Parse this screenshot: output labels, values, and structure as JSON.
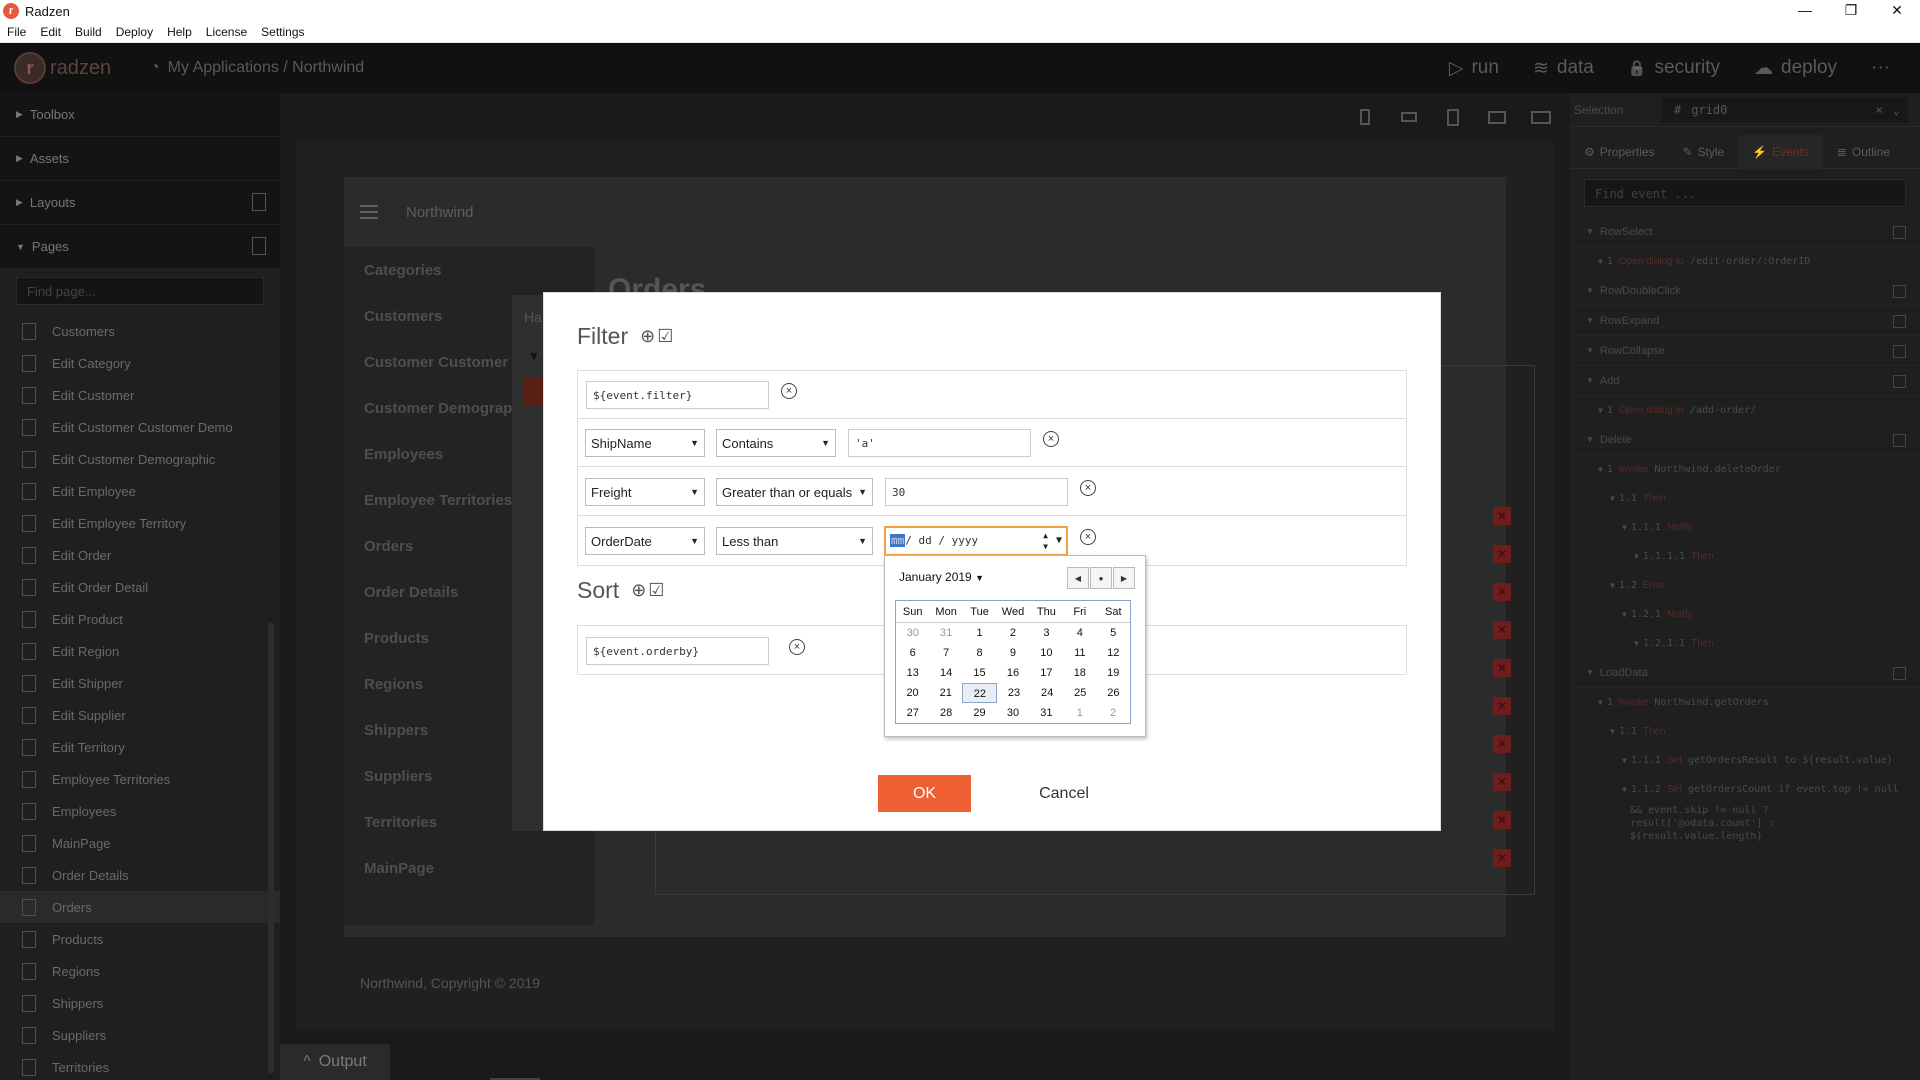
{
  "window": {
    "title": "Radzen",
    "controls": [
      "—",
      "❐",
      "✕"
    ]
  },
  "menu": [
    "File",
    "Edit",
    "Build",
    "Deploy",
    "Help",
    "License",
    "Settings"
  ],
  "header": {
    "brand": "radzen",
    "breadcrumb": "My Applications / Northwind",
    "nav": [
      {
        "icon": "play-icon",
        "glyph": "▷",
        "label": "run"
      },
      {
        "icon": "database-icon",
        "glyph": "≋",
        "label": "data"
      },
      {
        "icon": "lock-icon",
        "glyph": "🔒",
        "label": "security"
      },
      {
        "icon": "cloud-upload-icon",
        "glyph": "☁",
        "label": "deploy"
      }
    ],
    "more": "···"
  },
  "sidebar": {
    "sections": [
      "Toolbox",
      "Assets",
      "Layouts",
      "Pages"
    ],
    "search_placeholder": "Find page...",
    "pages": [
      "Customers",
      "Edit Category",
      "Edit Customer",
      "Edit Customer Customer Demo",
      "Edit Customer Demographic",
      "Edit Employee",
      "Edit Employee Territory",
      "Edit Order",
      "Edit Order Detail",
      "Edit Product",
      "Edit Region",
      "Edit Shipper",
      "Edit Supplier",
      "Edit Territory",
      "Employee Territories",
      "Employees",
      "MainPage",
      "Order Details",
      "Orders",
      "Products",
      "Regions",
      "Shippers",
      "Suppliers",
      "Territories"
    ],
    "active_page": "Orders"
  },
  "canvas": {
    "app_title": "Northwind",
    "nav": [
      "Categories",
      "Customers",
      "Customer Customer De",
      "Customer Demographi",
      "Employees",
      "Employee Territories",
      "Orders",
      "Order Details",
      "Products",
      "Regions",
      "Shippers",
      "Suppliers",
      "Territories",
      "MainPage"
    ],
    "content_title": "Orders",
    "footer": "Northwind, Copyright © 2019",
    "partial_label": "Ha"
  },
  "right_panel": {
    "selection_label": "Selection",
    "selection_value": "grid0",
    "tabs": [
      "Properties",
      "Style",
      "Events",
      "Outline"
    ],
    "active_tab": "Events",
    "find_placeholder": "Find event ...",
    "events": [
      {
        "name": "RowSelect",
        "actions": [
          {
            "indent": 1,
            "num": "1",
            "kind": "Open dialog to",
            "target": "/edit-order/:OrderID"
          }
        ]
      },
      {
        "name": "RowDoubleClick",
        "actions": []
      },
      {
        "name": "RowExpand",
        "actions": []
      },
      {
        "name": "RowCollapse",
        "actions": []
      },
      {
        "name": "Add",
        "actions": [
          {
            "indent": 1,
            "num": "1",
            "kind": "Open dialog to",
            "target": "/add-order/"
          }
        ]
      },
      {
        "name": "Delete",
        "actions": [
          {
            "indent": 1,
            "num": "1",
            "kind": "Invoke",
            "target": "Northwind.deleteOrder"
          },
          {
            "indent": 2,
            "num": "1.1",
            "kind": "Then",
            "target": ""
          },
          {
            "indent": 3,
            "num": "1.1.1",
            "kind": "Notify",
            "target": ""
          },
          {
            "indent": 4,
            "num": "1.1.1.1",
            "kind": "Then",
            "target": ""
          },
          {
            "indent": 2,
            "num": "1.2",
            "kind": "Error",
            "target": ""
          },
          {
            "indent": 3,
            "num": "1.2.1",
            "kind": "Notify",
            "target": ""
          },
          {
            "indent": 4,
            "num": "1.2.1.1",
            "kind": "Then",
            "target": ""
          }
        ]
      },
      {
        "name": "LoadData",
        "actions": [
          {
            "indent": 1,
            "num": "1",
            "kind": "Invoke",
            "target": "Northwind.getOrders"
          },
          {
            "indent": 2,
            "num": "1.1",
            "kind": "Then",
            "target": ""
          },
          {
            "indent": 3,
            "num": "1.1.1",
            "kind": "Set",
            "target": "getOrdersResult to ${result.value}"
          },
          {
            "indent": 3,
            "num": "1.1.2",
            "kind": "Set",
            "target": "getOrdersCount if event.top != null"
          }
        ]
      }
    ],
    "code_tail": [
      "&& event.skip != null ?",
      "result['@odata.count'] :",
      "${result.value.length}"
    ]
  },
  "output_label": "Output",
  "dialog": {
    "filter_title": "Filter",
    "sort_title": "Sort",
    "section_icons": "⊕☑",
    "filter_expression": "${event.filter}",
    "rows": [
      {
        "field": "ShipName",
        "operator": "Contains",
        "value": "'a'"
      },
      {
        "field": "Freight",
        "operator": "Greater than or equals",
        "value": "30"
      },
      {
        "field": "OrderDate",
        "operator": "Less than",
        "date_mm": "mm",
        "date_rest": "/ dd / yyyy"
      }
    ],
    "sort_expression": "${event.orderby}",
    "ok_label": "OK",
    "cancel_label": "Cancel"
  },
  "calendar": {
    "month_label": "January 2019",
    "days_of_week": [
      "Sun",
      "Mon",
      "Tue",
      "Wed",
      "Thu",
      "Fri",
      "Sat"
    ],
    "weeks": [
      [
        "30",
        "31",
        "1",
        "2",
        "3",
        "4",
        "5"
      ],
      [
        "6",
        "7",
        "8",
        "9",
        "10",
        "11",
        "12"
      ],
      [
        "13",
        "14",
        "15",
        "16",
        "17",
        "18",
        "19"
      ],
      [
        "20",
        "21",
        "22",
        "23",
        "24",
        "25",
        "26"
      ],
      [
        "27",
        "28",
        "29",
        "30",
        "31",
        "1",
        "2"
      ]
    ],
    "today": "22"
  }
}
